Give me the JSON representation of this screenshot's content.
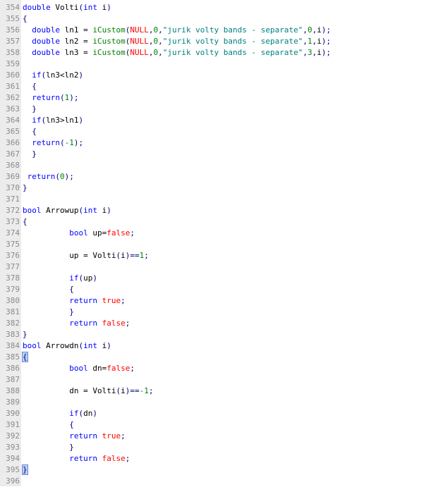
{
  "colors": {
    "keyword": "#0000ff",
    "string": "#008080",
    "number": "#008000",
    "literal": "#ff0000",
    "punctuation": "#000080",
    "gutter_bg": "#ececec",
    "line_number": "#8a8a8a",
    "brace_highlight": "#b8d0f4"
  },
  "lines": [
    {
      "n": "354",
      "tokens": [
        {
          "t": "double",
          "k": "kw"
        },
        {
          "t": " Volti",
          "k": "ident"
        },
        {
          "t": "(",
          "k": "punc"
        },
        {
          "t": "int",
          "k": "kw"
        },
        {
          "t": " i",
          "k": "ident"
        },
        {
          "t": ")",
          "k": "punc"
        }
      ]
    },
    {
      "n": "355",
      "tokens": [
        {
          "t": "{",
          "k": "punc"
        }
      ]
    },
    {
      "n": "356",
      "tokens": [
        {
          "t": "  ",
          "k": "ident"
        },
        {
          "t": "double",
          "k": "kw"
        },
        {
          "t": " ln1 = ",
          "k": "ident"
        },
        {
          "t": "iCustom",
          "k": "num"
        },
        {
          "t": "(",
          "k": "punc"
        },
        {
          "t": "NULL",
          "k": "lit"
        },
        {
          "t": ",",
          "k": "punc"
        },
        {
          "t": "0",
          "k": "num"
        },
        {
          "t": ",",
          "k": "punc"
        },
        {
          "t": "\"jurik volty bands - separate\"",
          "k": "str"
        },
        {
          "t": ",",
          "k": "punc"
        },
        {
          "t": "0",
          "k": "num"
        },
        {
          "t": ",",
          "k": "punc"
        },
        {
          "t": "i",
          "k": "ident"
        },
        {
          "t": ");",
          "k": "punc"
        }
      ]
    },
    {
      "n": "357",
      "tokens": [
        {
          "t": "  ",
          "k": "ident"
        },
        {
          "t": "double",
          "k": "kw"
        },
        {
          "t": " ln2 = ",
          "k": "ident"
        },
        {
          "t": "iCustom",
          "k": "num"
        },
        {
          "t": "(",
          "k": "punc"
        },
        {
          "t": "NULL",
          "k": "lit"
        },
        {
          "t": ",",
          "k": "punc"
        },
        {
          "t": "0",
          "k": "num"
        },
        {
          "t": ",",
          "k": "punc"
        },
        {
          "t": "\"jurik volty bands - separate\"",
          "k": "str"
        },
        {
          "t": ",",
          "k": "punc"
        },
        {
          "t": "1",
          "k": "num"
        },
        {
          "t": ",",
          "k": "punc"
        },
        {
          "t": "i",
          "k": "ident"
        },
        {
          "t": ");",
          "k": "punc"
        }
      ]
    },
    {
      "n": "358",
      "tokens": [
        {
          "t": "  ",
          "k": "ident"
        },
        {
          "t": "double",
          "k": "kw"
        },
        {
          "t": " ln3 = ",
          "k": "ident"
        },
        {
          "t": "iCustom",
          "k": "num"
        },
        {
          "t": "(",
          "k": "punc"
        },
        {
          "t": "NULL",
          "k": "lit"
        },
        {
          "t": ",",
          "k": "punc"
        },
        {
          "t": "0",
          "k": "num"
        },
        {
          "t": ",",
          "k": "punc"
        },
        {
          "t": "\"jurik volty bands - separate\"",
          "k": "str"
        },
        {
          "t": ",",
          "k": "punc"
        },
        {
          "t": "3",
          "k": "num"
        },
        {
          "t": ",",
          "k": "punc"
        },
        {
          "t": "i",
          "k": "ident"
        },
        {
          "t": ");",
          "k": "punc"
        }
      ]
    },
    {
      "n": "359",
      "tokens": []
    },
    {
      "n": "360",
      "tokens": [
        {
          "t": "  ",
          "k": "ident"
        },
        {
          "t": "if",
          "k": "kw"
        },
        {
          "t": "(",
          "k": "punc"
        },
        {
          "t": "ln3<ln2",
          "k": "ident"
        },
        {
          "t": ")",
          "k": "punc"
        }
      ]
    },
    {
      "n": "361",
      "tokens": [
        {
          "t": "  ",
          "k": "ident"
        },
        {
          "t": "{",
          "k": "punc"
        }
      ]
    },
    {
      "n": "362",
      "tokens": [
        {
          "t": "  ",
          "k": "ident"
        },
        {
          "t": "return",
          "k": "kw"
        },
        {
          "t": "(",
          "k": "punc"
        },
        {
          "t": "1",
          "k": "num"
        },
        {
          "t": ");",
          "k": "punc"
        }
      ]
    },
    {
      "n": "363",
      "tokens": [
        {
          "t": "  ",
          "k": "ident"
        },
        {
          "t": "}",
          "k": "punc"
        }
      ]
    },
    {
      "n": "364",
      "tokens": [
        {
          "t": "  ",
          "k": "ident"
        },
        {
          "t": "if",
          "k": "kw"
        },
        {
          "t": "(",
          "k": "punc"
        },
        {
          "t": "ln3>ln1",
          "k": "ident"
        },
        {
          "t": ")",
          "k": "punc"
        }
      ]
    },
    {
      "n": "365",
      "tokens": [
        {
          "t": "  ",
          "k": "ident"
        },
        {
          "t": "{",
          "k": "punc"
        }
      ]
    },
    {
      "n": "366",
      "tokens": [
        {
          "t": "  ",
          "k": "ident"
        },
        {
          "t": "return",
          "k": "kw"
        },
        {
          "t": "(",
          "k": "punc"
        },
        {
          "t": "-1",
          "k": "num"
        },
        {
          "t": ");",
          "k": "punc"
        }
      ]
    },
    {
      "n": "367",
      "tokens": [
        {
          "t": "  ",
          "k": "ident"
        },
        {
          "t": "}",
          "k": "punc"
        }
      ]
    },
    {
      "n": "368",
      "tokens": []
    },
    {
      "n": "369",
      "tokens": [
        {
          "t": " ",
          "k": "ident"
        },
        {
          "t": "return",
          "k": "kw"
        },
        {
          "t": "(",
          "k": "punc"
        },
        {
          "t": "0",
          "k": "num"
        },
        {
          "t": ");",
          "k": "punc"
        }
      ]
    },
    {
      "n": "370",
      "tokens": [
        {
          "t": "}",
          "k": "punc"
        }
      ]
    },
    {
      "n": "371",
      "tokens": []
    },
    {
      "n": "372",
      "tokens": [
        {
          "t": "bool",
          "k": "kw"
        },
        {
          "t": " Arrowup",
          "k": "ident"
        },
        {
          "t": "(",
          "k": "punc"
        },
        {
          "t": "int",
          "k": "kw"
        },
        {
          "t": " i",
          "k": "ident"
        },
        {
          "t": ")",
          "k": "punc"
        }
      ]
    },
    {
      "n": "373",
      "tokens": [
        {
          "t": "{",
          "k": "punc"
        }
      ]
    },
    {
      "n": "374",
      "tokens": [
        {
          "t": "          ",
          "k": "ident"
        },
        {
          "t": "bool",
          "k": "kw"
        },
        {
          "t": " up=",
          "k": "ident"
        },
        {
          "t": "false",
          "k": "lit"
        },
        {
          "t": ";",
          "k": "punc"
        }
      ]
    },
    {
      "n": "375",
      "tokens": []
    },
    {
      "n": "376",
      "tokens": [
        {
          "t": "          ",
          "k": "ident"
        },
        {
          "t": "up = Volti",
          "k": "ident"
        },
        {
          "t": "(",
          "k": "punc"
        },
        {
          "t": "i",
          "k": "ident"
        },
        {
          "t": ")==",
          "k": "punc"
        },
        {
          "t": "1",
          "k": "num"
        },
        {
          "t": ";",
          "k": "punc"
        }
      ]
    },
    {
      "n": "377",
      "tokens": []
    },
    {
      "n": "378",
      "tokens": [
        {
          "t": "          ",
          "k": "ident"
        },
        {
          "t": "if",
          "k": "kw"
        },
        {
          "t": "(",
          "k": "punc"
        },
        {
          "t": "up",
          "k": "ident"
        },
        {
          "t": ")",
          "k": "punc"
        }
      ]
    },
    {
      "n": "379",
      "tokens": [
        {
          "t": "          ",
          "k": "ident"
        },
        {
          "t": "{",
          "k": "punc"
        }
      ]
    },
    {
      "n": "380",
      "tokens": [
        {
          "t": "          ",
          "k": "ident"
        },
        {
          "t": "return",
          "k": "kw"
        },
        {
          "t": " ",
          "k": "ident"
        },
        {
          "t": "true",
          "k": "lit"
        },
        {
          "t": ";",
          "k": "punc"
        }
      ]
    },
    {
      "n": "381",
      "tokens": [
        {
          "t": "          ",
          "k": "ident"
        },
        {
          "t": "}",
          "k": "punc"
        }
      ]
    },
    {
      "n": "382",
      "tokens": [
        {
          "t": "          ",
          "k": "ident"
        },
        {
          "t": "return",
          "k": "kw"
        },
        {
          "t": " ",
          "k": "ident"
        },
        {
          "t": "false",
          "k": "lit"
        },
        {
          "t": ";",
          "k": "punc"
        }
      ]
    },
    {
      "n": "383",
      "tokens": [
        {
          "t": "}",
          "k": "punc"
        }
      ]
    },
    {
      "n": "384",
      "tokens": [
        {
          "t": "bool",
          "k": "kw"
        },
        {
          "t": " Arrowdn",
          "k": "ident"
        },
        {
          "t": "(",
          "k": "punc"
        },
        {
          "t": "int",
          "k": "kw"
        },
        {
          "t": " i",
          "k": "ident"
        },
        {
          "t": ")",
          "k": "punc"
        }
      ]
    },
    {
      "n": "385",
      "tokens": [
        {
          "t": "{",
          "k": "brace-hl"
        }
      ]
    },
    {
      "n": "386",
      "tokens": [
        {
          "t": "          ",
          "k": "ident"
        },
        {
          "t": "bool",
          "k": "kw"
        },
        {
          "t": " dn=",
          "k": "ident"
        },
        {
          "t": "false",
          "k": "lit"
        },
        {
          "t": ";",
          "k": "punc"
        }
      ]
    },
    {
      "n": "387",
      "tokens": []
    },
    {
      "n": "388",
      "tokens": [
        {
          "t": "          ",
          "k": "ident"
        },
        {
          "t": "dn = Volti",
          "k": "ident"
        },
        {
          "t": "(",
          "k": "punc"
        },
        {
          "t": "i",
          "k": "ident"
        },
        {
          "t": ")==",
          "k": "punc"
        },
        {
          "t": "-1",
          "k": "num"
        },
        {
          "t": ";",
          "k": "punc"
        }
      ]
    },
    {
      "n": "389",
      "tokens": []
    },
    {
      "n": "390",
      "tokens": [
        {
          "t": "          ",
          "k": "ident"
        },
        {
          "t": "if",
          "k": "kw"
        },
        {
          "t": "(",
          "k": "punc"
        },
        {
          "t": "dn",
          "k": "ident"
        },
        {
          "t": ")",
          "k": "punc"
        }
      ]
    },
    {
      "n": "391",
      "tokens": [
        {
          "t": "          ",
          "k": "ident"
        },
        {
          "t": "{",
          "k": "punc"
        }
      ]
    },
    {
      "n": "392",
      "tokens": [
        {
          "t": "          ",
          "k": "ident"
        },
        {
          "t": "return",
          "k": "kw"
        },
        {
          "t": " ",
          "k": "ident"
        },
        {
          "t": "true",
          "k": "lit"
        },
        {
          "t": ";",
          "k": "punc"
        }
      ]
    },
    {
      "n": "393",
      "tokens": [
        {
          "t": "          ",
          "k": "ident"
        },
        {
          "t": "}",
          "k": "punc"
        }
      ]
    },
    {
      "n": "394",
      "tokens": [
        {
          "t": "          ",
          "k": "ident"
        },
        {
          "t": "return",
          "k": "kw"
        },
        {
          "t": " ",
          "k": "ident"
        },
        {
          "t": "false",
          "k": "lit"
        },
        {
          "t": ";",
          "k": "punc"
        }
      ]
    },
    {
      "n": "395",
      "tokens": [
        {
          "t": "}",
          "k": "brace-hl"
        }
      ]
    },
    {
      "n": "396",
      "tokens": []
    }
  ]
}
